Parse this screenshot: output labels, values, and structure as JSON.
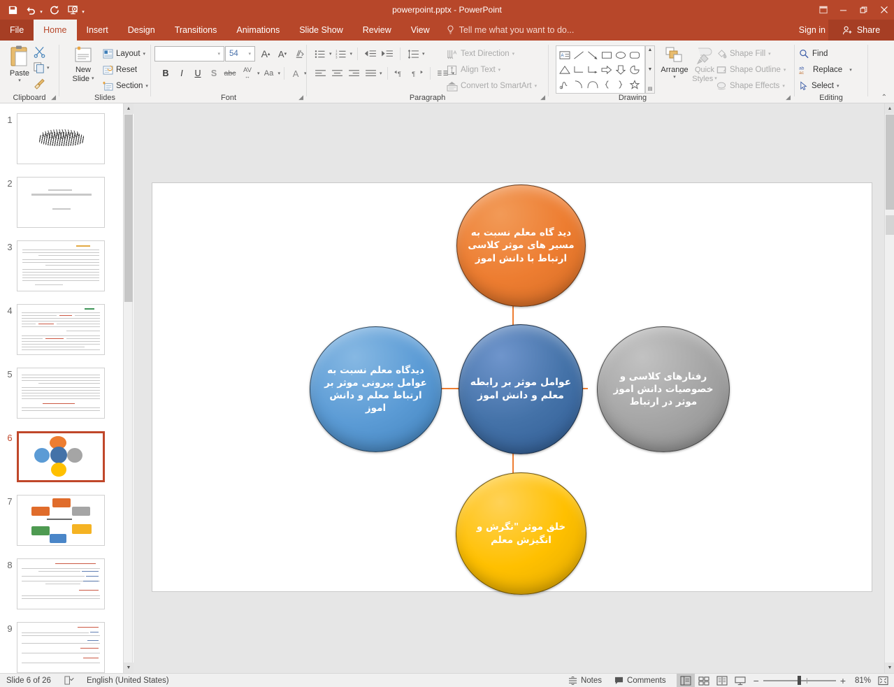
{
  "window": {
    "title": "powerpoint.pptx - PowerPoint",
    "quick_access": [
      {
        "name": "save-icon",
        "label": "Save"
      },
      {
        "name": "undo-icon",
        "label": "Undo"
      },
      {
        "name": "redo-icon",
        "label": "Redo"
      },
      {
        "name": "start-slideshow-icon",
        "label": "Start From Beginning"
      },
      {
        "name": "customize-qat-icon",
        "label": "Customize Quick Access Toolbar"
      }
    ],
    "controls": {
      "minimize": "–",
      "restore": "❐",
      "close": "✕",
      "ribbon_display": "❐"
    }
  },
  "tabs": [
    {
      "label": "File",
      "active": false,
      "file": true
    },
    {
      "label": "Home",
      "active": true,
      "file": false
    },
    {
      "label": "Insert",
      "active": false,
      "file": false
    },
    {
      "label": "Design",
      "active": false,
      "file": false
    },
    {
      "label": "Transitions",
      "active": false,
      "file": false
    },
    {
      "label": "Animations",
      "active": false,
      "file": false
    },
    {
      "label": "Slide Show",
      "active": false,
      "file": false
    },
    {
      "label": "Review",
      "active": false,
      "file": false
    },
    {
      "label": "View",
      "active": false,
      "file": false
    }
  ],
  "tellme": {
    "placeholder": "Tell me what you want to do..."
  },
  "account": {
    "signin": "Sign in",
    "share": "Share"
  },
  "ribbon": {
    "groups": [
      {
        "label": "Clipboard"
      },
      {
        "label": "Slides"
      },
      {
        "label": "Font"
      },
      {
        "label": "Paragraph"
      },
      {
        "label": "Drawing"
      },
      {
        "label": "Editing"
      }
    ],
    "clipboard": {
      "paste": "Paste",
      "cut": "Cut",
      "copy": "Copy",
      "format_painter": "Format Painter"
    },
    "slides": {
      "new_slide": "New\nSlide",
      "new_slide_l1": "New",
      "new_slide_l2": "Slide",
      "layout": "Layout",
      "reset": "Reset",
      "section": "Section"
    },
    "font": {
      "font_name_value": "",
      "font_size_value": "54",
      "grow": "A",
      "shrink": "A",
      "clear_formatting": "Clear All Formatting",
      "bold": "B",
      "italic": "I",
      "underline": "U",
      "shadow": "S",
      "strikethrough": "abc",
      "character_spacing": "AV",
      "change_case": "Aa",
      "font_color": "A"
    },
    "paragraph": {
      "text_direction": "Text Direction",
      "align_text": "Align Text",
      "convert_to_smartart": "Convert to SmartArt"
    },
    "drawing": {
      "arrange": "Arrange",
      "quick_styles_l1": "Quick",
      "quick_styles_l2": "Styles",
      "shape_fill": "Shape Fill",
      "shape_outline": "Shape Outline",
      "shape_effects": "Shape Effects"
    },
    "editing": {
      "find": "Find",
      "replace": "Replace",
      "select": "Select"
    }
  },
  "thumbnails": [
    {
      "number": "1",
      "kind": "bismillah",
      "selected": false
    },
    {
      "number": "2",
      "kind": "title",
      "selected": false
    },
    {
      "number": "3",
      "kind": "text-orange",
      "selected": false
    },
    {
      "number": "4",
      "kind": "text-red",
      "selected": false
    },
    {
      "number": "5",
      "kind": "text-plain",
      "selected": false
    },
    {
      "number": "6",
      "kind": "diagram-circles",
      "selected": true
    },
    {
      "number": "7",
      "kind": "diagram-boxes",
      "selected": false
    },
    {
      "number": "8",
      "kind": "text-red",
      "selected": false
    },
    {
      "number": "9",
      "kind": "text-red",
      "selected": false
    }
  ],
  "slide": {
    "diagram": {
      "type": "radial-circles",
      "nodes": [
        {
          "id": "top",
          "text": "دید گاه معلم نسبت به مسیر های موثر کلاسی ارتباط با دانش اموز",
          "color": "#ED7D31"
        },
        {
          "id": "left",
          "text": "دیدگاه معلم نسبت به عوامل بیرونی موثر بر ارتباط معلم و دانش اموز",
          "color": "#5B9BD5"
        },
        {
          "id": "center",
          "text": "عوامل موثر بر رابطه معلم و دانش اموز",
          "color": "#4472A8"
        },
        {
          "id": "right",
          "text": "رفتارهای کلاسی و خصوصیات دانش اموز موثر در ارتباط",
          "color": "#A5A5A5"
        },
        {
          "id": "bottom",
          "text": "خلق موثر \"نگرش و انگیزش معلم",
          "color": "#FFC000"
        }
      ],
      "connector_color": "#ED7D31"
    }
  },
  "statusbar": {
    "slide_count": "Slide 6 of 26",
    "language": "English (United States)",
    "notes": "Notes",
    "comments": "Comments",
    "zoom_level": "81%",
    "zoom_minus": "−",
    "zoom_plus": "+",
    "views": [
      {
        "name": "normal-view-button",
        "active": true
      },
      {
        "name": "slide-sorter-view-button",
        "active": false
      },
      {
        "name": "reading-view-button",
        "active": false
      },
      {
        "name": "slideshow-view-button",
        "active": false
      }
    ]
  }
}
